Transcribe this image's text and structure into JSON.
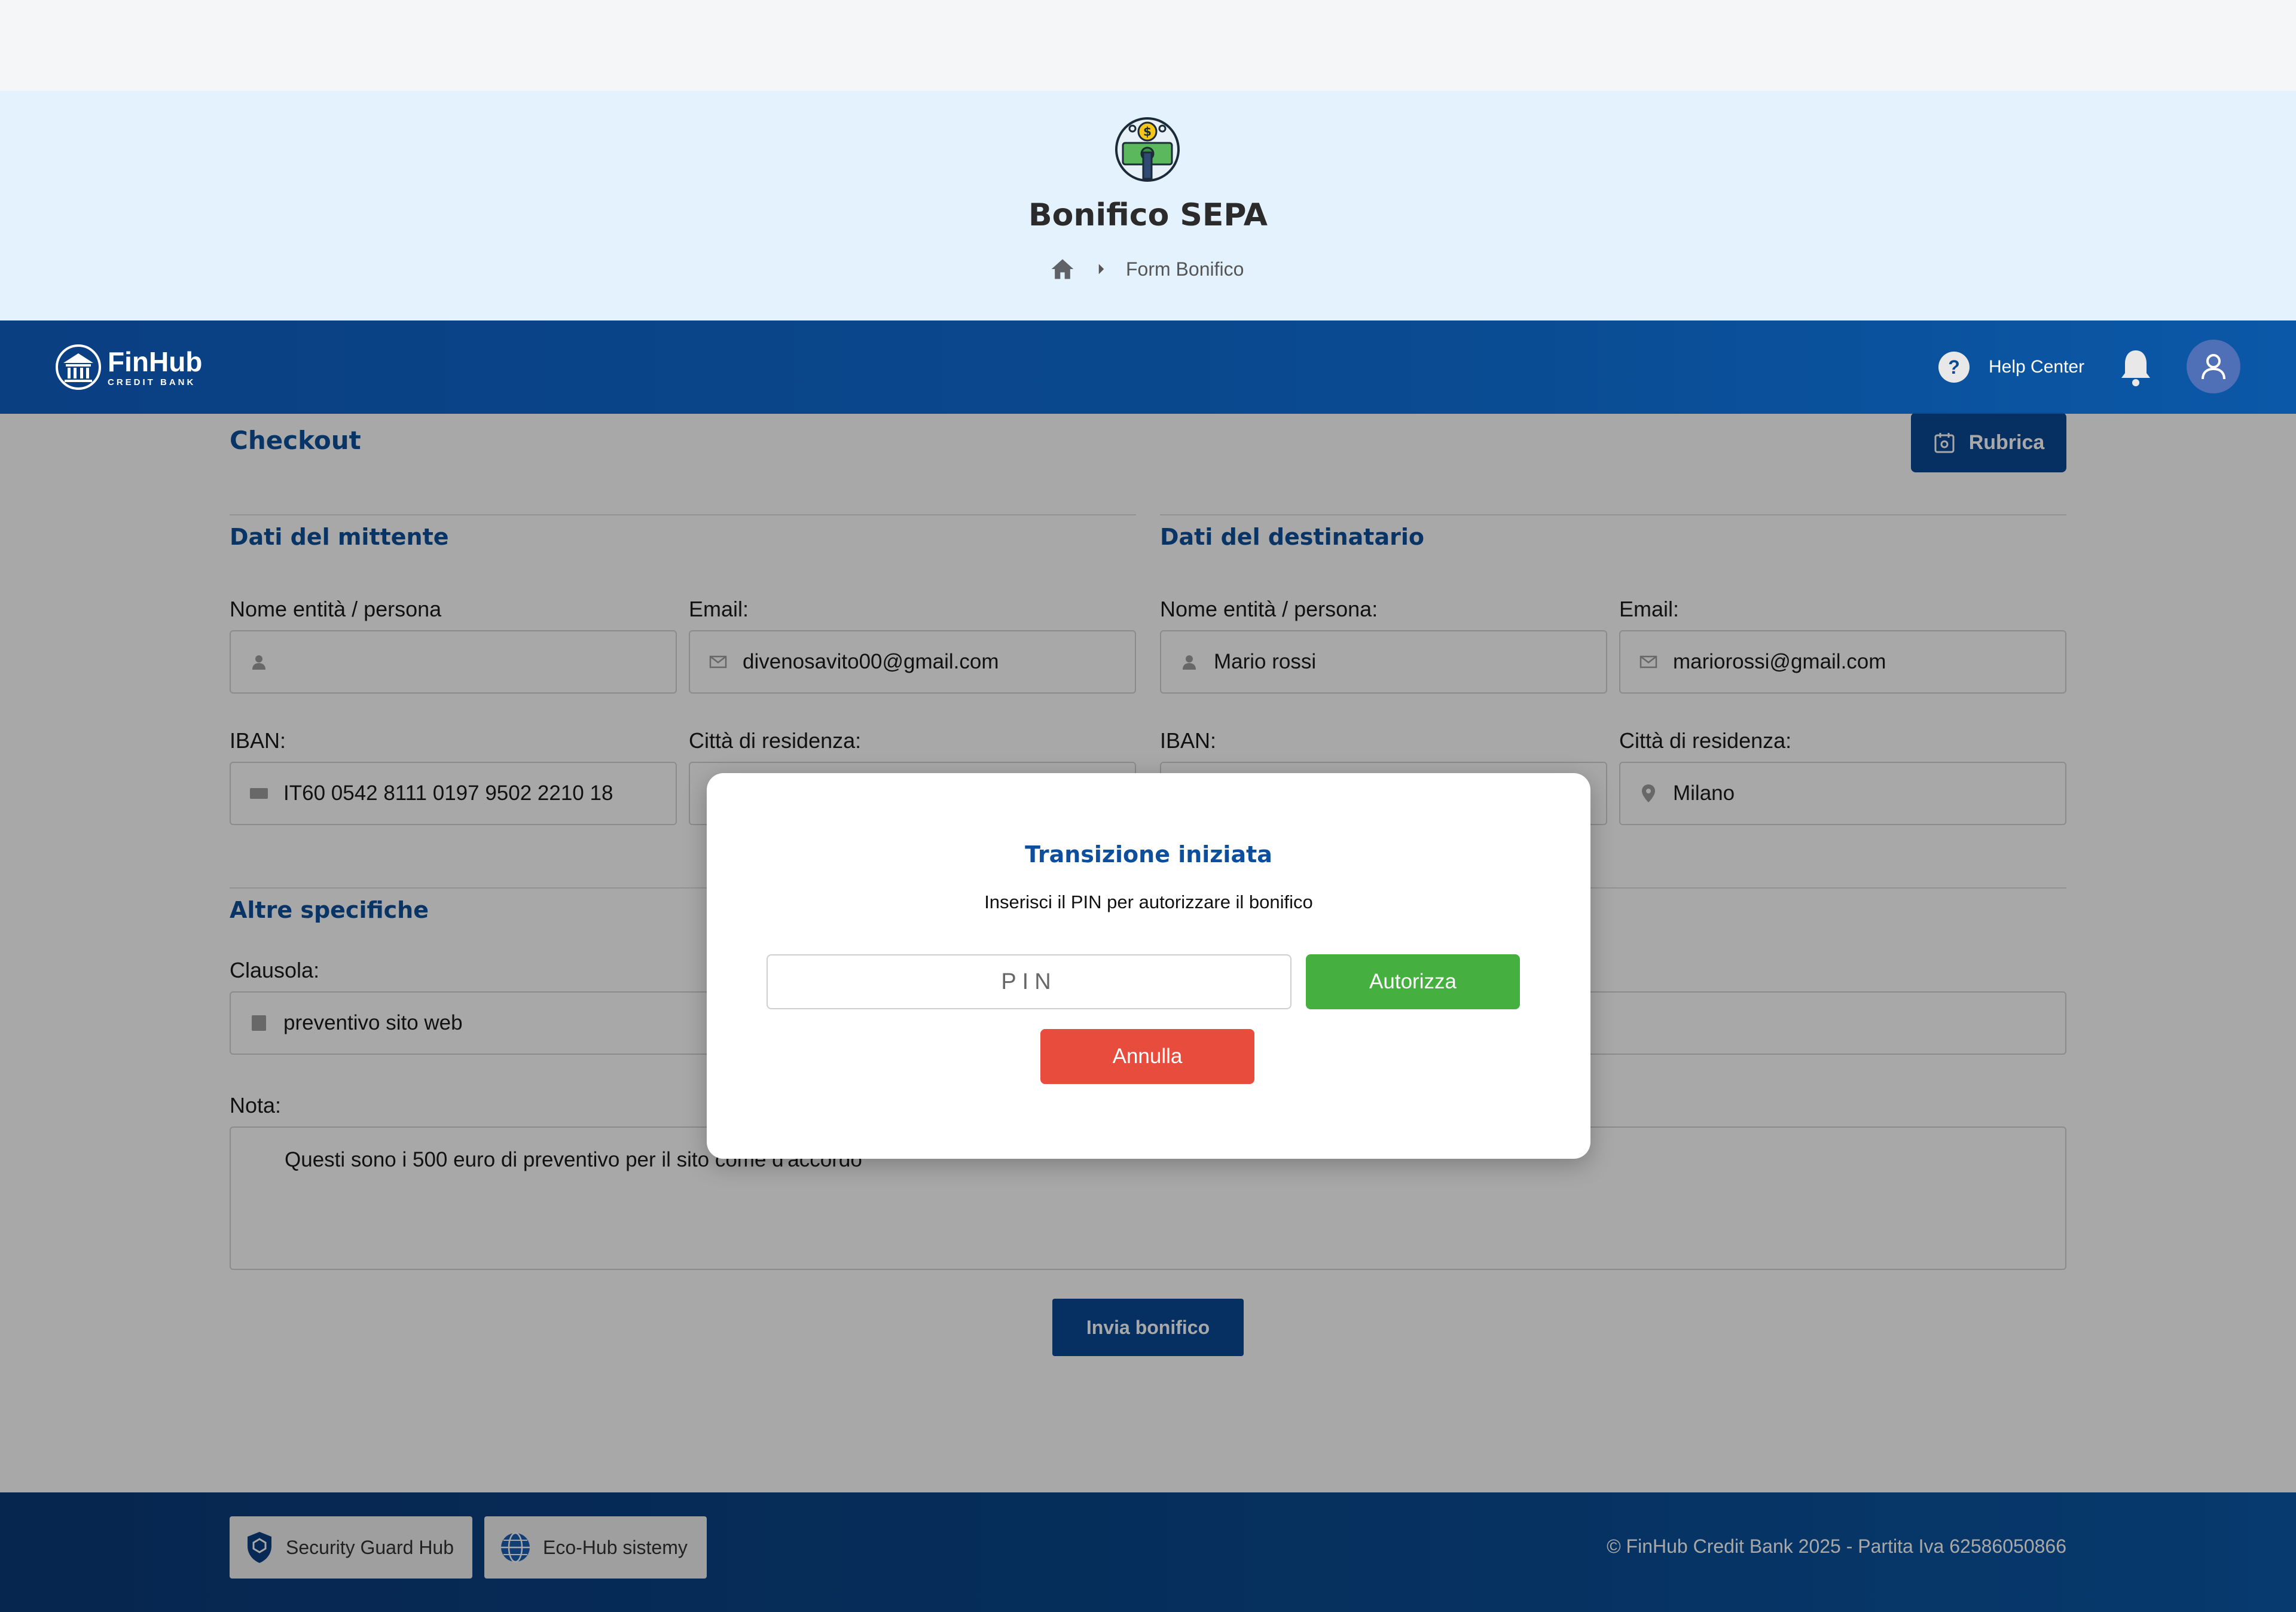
{
  "hero": {
    "title": "Bonifico SEPA",
    "breadcrumb": "Form Bonifico"
  },
  "navbar": {
    "brand_name": "FinHub",
    "brand_sub": "CREDIT BANK",
    "help_label": "Help Center"
  },
  "form": {
    "title": "Checkout",
    "address_book_label": "Rubrica",
    "sender": {
      "title": "Dati del mittente",
      "name_label": "Nome entità / persona",
      "name_value": "",
      "email_label": "Email:",
      "email_value": "divenosavito00@gmail.com",
      "iban_label": "IBAN:",
      "iban_value": "IT60 0542 8111 0197 9502 2210 18",
      "city_label": "Città di residenza:"
    },
    "recipient": {
      "title": "Dati del destinatario",
      "name_label": "Nome entità / persona:",
      "name_value": "Mario rossi",
      "email_label": "Email:",
      "email_value": "mariorossi@gmail.com",
      "iban_label": "IBAN:",
      "city_label": "Città di residenza:",
      "city_value": "Milano"
    },
    "other": {
      "title": "Altre specifiche",
      "clause_label": "Clausola:",
      "clause_value": "preventivo sito web",
      "note_label": "Nota:",
      "note_value": "Questi sono i 500 euro di preventivo per il sito come d'accordo"
    },
    "submit_label": "Invia bonifico"
  },
  "modal": {
    "title": "Transizione iniziata",
    "subtitle": "Inserisci il PIN per autorizzare il bonifico",
    "pin_placeholder": "PIN",
    "authorize_label": "Autorizza",
    "cancel_label": "Annulla"
  },
  "footer": {
    "badge1": "Security Guard Hub",
    "badge2": "Eco-Hub sistemy",
    "copyright": "© FinHub Credit Bank 2025 - Partita Iva 62586050866"
  },
  "colors": {
    "primary": "#0a4a94",
    "heading": "#0d4f9c",
    "success": "#45b03f",
    "danger": "#e74c3c",
    "hero_bg": "#e3f2fd"
  }
}
